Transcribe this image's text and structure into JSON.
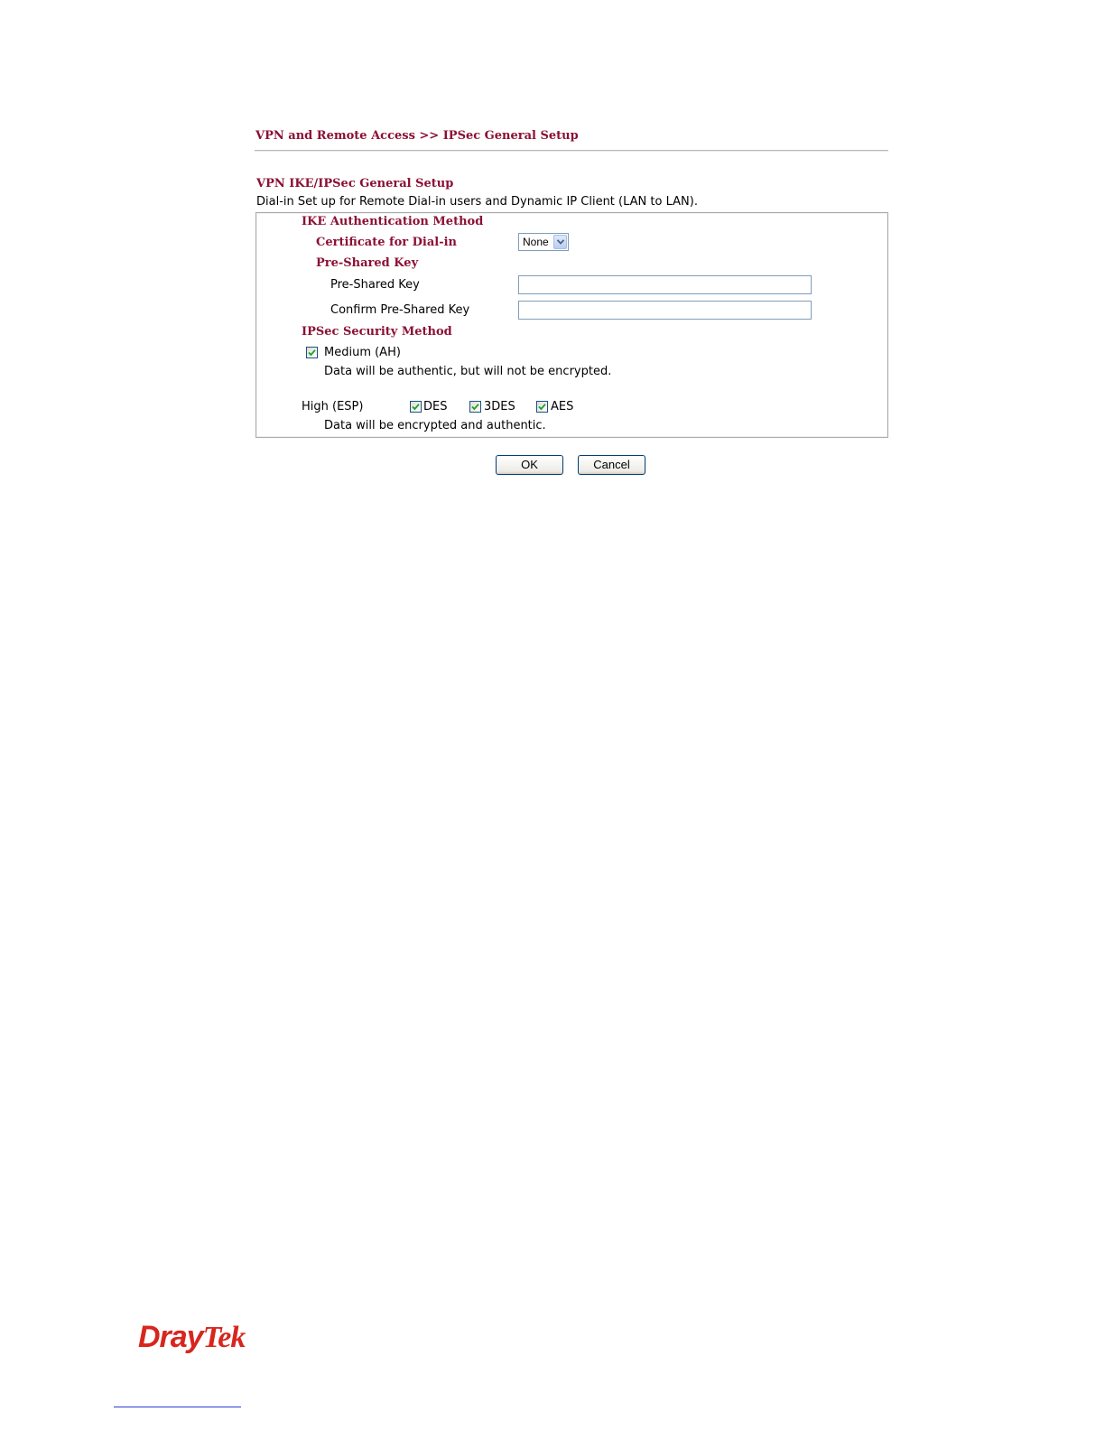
{
  "breadcrumb": "VPN and Remote Access >> IPSec General Setup",
  "section": {
    "title": "VPN IKE/IPSec General Setup",
    "description": "Dial-in Set up for Remote Dial-in users and Dynamic IP Client (LAN to LAN)."
  },
  "ike": {
    "heading": "IKE Authentication Method",
    "certificate_label": "Certificate for Dial-in",
    "certificate_value": "None",
    "psk_heading": "Pre-Shared Key",
    "psk_label": "Pre-Shared Key",
    "psk_value": "",
    "confirm_psk_label": "Confirm Pre-Shared Key",
    "confirm_psk_value": ""
  },
  "ipsec": {
    "heading": "IPSec Security Method",
    "medium_label": "Medium (AH)",
    "medium_checked": true,
    "medium_desc": "Data will be authentic, but will not be encrypted.",
    "high_label": "High (ESP)",
    "des_label": "DES",
    "des_checked": true,
    "tdes_label": "3DES",
    "tdes_checked": true,
    "aes_label": "AES",
    "aes_checked": true,
    "high_desc": "Data will be encrypted and authentic."
  },
  "buttons": {
    "ok": "OK",
    "cancel": "Cancel"
  },
  "logo": {
    "part1": "Dray",
    "part2": "Tek"
  },
  "colors": {
    "heading": "#8b1035",
    "logo": "#d7261e"
  }
}
